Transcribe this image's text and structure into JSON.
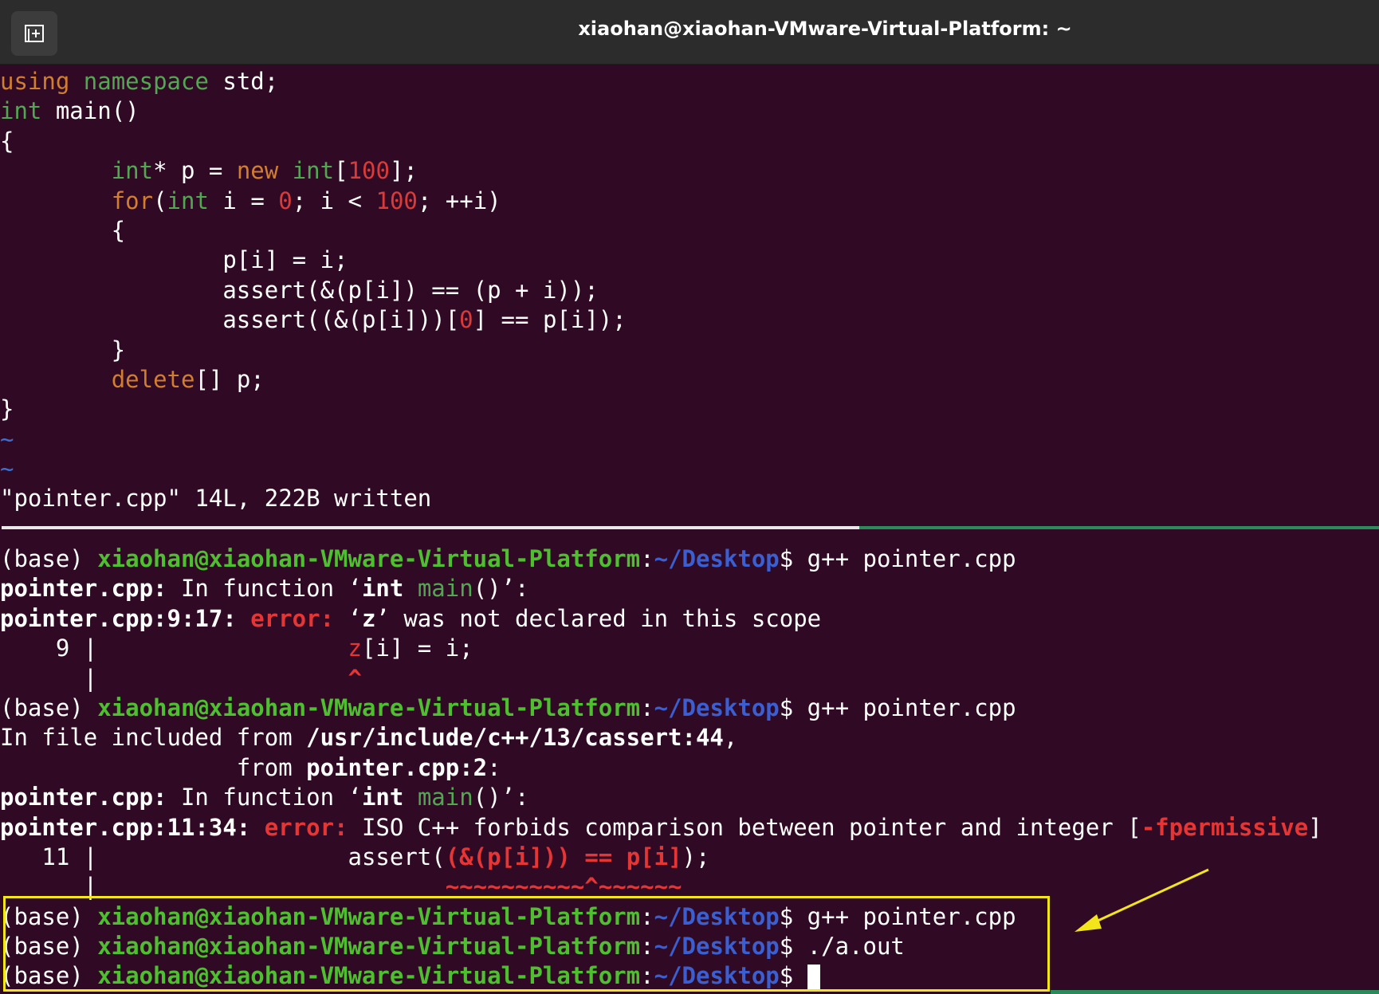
{
  "window": {
    "title": "xiaohan@xiaohan-VMware-Virtual-Platform: ~",
    "new_tab_icon": "new-tab-icon"
  },
  "editor": {
    "l1": {
      "a": "using",
      "b": " ",
      "c": "namespace",
      "d": " std;"
    },
    "l2": {
      "a": "int",
      "b": " main()"
    },
    "l3": "{",
    "l4": {
      "ind": "        ",
      "a": "int",
      "b": "* p = ",
      "c": "new",
      "d": " ",
      "e": "int",
      "f": "[",
      "g": "100",
      "h": "];"
    },
    "l5": {
      "ind": "        ",
      "a": "for",
      "b": "(",
      "c": "int",
      "d": " i = ",
      "e": "0",
      "f": "; i < ",
      "g": "100",
      "h": "; ++i)"
    },
    "l6": "        {",
    "l7": "                p[i] = i;",
    "l8": "                assert(&(p[i]) == (p + i));",
    "l9": {
      "a": "                assert((&(p[i]))[",
      "b": "0",
      "c": "] == p[i]);"
    },
    "l10": "        }",
    "l11": {
      "ind": "        ",
      "a": "delete",
      "b": "[] p;"
    },
    "l12": "}",
    "tilde": "~",
    "status": "\"pointer.cpp\" 14L, 222B written"
  },
  "terminal": {
    "prompt_prefix": "(base) ",
    "user_host": "xiaohan@xiaohan-VMware-Virtual-Platform",
    "colon": ":",
    "path": "~/Desktop",
    "dollar": "$ ",
    "cmd1": "g++ pointer.cpp",
    "e1_file": "pointer.cpp:",
    "e1_infn": " In function ‘",
    "e1_int": "int",
    "e1_sp": " ",
    "e1_main": "main",
    "e1_end": "()’:",
    "e1_loc": "pointer.cpp:9:17:",
    "e1_err": " error:",
    "e1_q1": " ‘",
    "e1_z": "z",
    "e1_q2": "’",
    "e1_msg": " was not declared in this scope",
    "e1_ln": "    9 | ",
    "e1_code_ind": "                 ",
    "e1_code_z": "z",
    "e1_code_rest": "[i] = i;",
    "e1_mark_ln": "      | ",
    "e1_caret": "^",
    "cmd2": "g++ pointer.cpp",
    "inc1": "In file included from ",
    "inc1_path": "/usr/include/c++/13/cassert:44",
    "inc1_end": ",",
    "inc2": "                 from ",
    "inc2_path": "pointer.cpp:2",
    "inc2_end": ":",
    "e2_loc": "pointer.cpp:11:34:",
    "e2_err": " error:",
    "e2_msg": " ISO C++ forbids comparison between pointer and integer [",
    "e2_flag": "-fpermissive",
    "e2_close": "]",
    "e2_ln": "   11 | ",
    "e2_code_a": "assert(",
    "e2_code_b": "(&(p[i])) == p[i]",
    "e2_code_c": ");",
    "e2_mark_ln": "      |",
    "e2_mark": "        ~~~~~~~~~~^~~~~~~",
    "cmd3": "g++ pointer.cpp",
    "cmd4": "./a.out"
  },
  "annotation": {
    "color": "#f2e51a",
    "arrow_icon": "arrow-icon"
  }
}
